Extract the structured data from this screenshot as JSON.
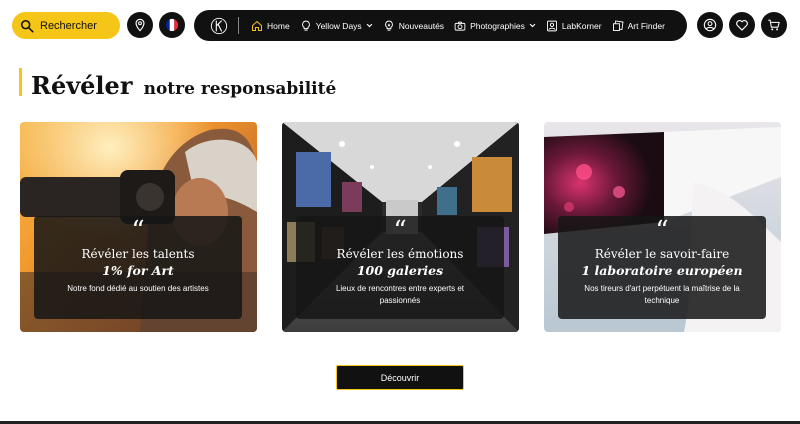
{
  "header": {
    "search": {
      "placeholder": "Rechercher",
      "icon": "search-icon"
    },
    "location_icon": "map-pin-icon",
    "language_icon": "french-flag-icon",
    "flag_colors": [
      "#002395",
      "#ffffff",
      "#ed2939"
    ],
    "nav": [
      {
        "label": "Home",
        "icon": "home-icon",
        "dropdown": false
      },
      {
        "label": "Yellow Days",
        "icon": "bulb-icon",
        "dropdown": true
      },
      {
        "label": "Nouveautés",
        "icon": "sparkle-bulb-icon",
        "dropdown": false
      },
      {
        "label": "Photographies",
        "icon": "camera-icon",
        "dropdown": true
      },
      {
        "label": "LabKorner",
        "icon": "portrait-icon",
        "dropdown": false
      },
      {
        "label": "Art Finder",
        "icon": "art-frames-icon",
        "dropdown": false
      }
    ],
    "account_icon": "user-icon",
    "wishlist_icon": "heart-icon",
    "cart_icon": "cart-icon"
  },
  "section": {
    "title_big": "Révéler",
    "title_small": "notre responsabilité"
  },
  "cards": [
    {
      "quote": "“",
      "title": "Révéler les talents",
      "stat": "1% for Art",
      "desc": "Notre fond dédié au soutien des artistes"
    },
    {
      "quote": "“",
      "title": "Révéler les émotions",
      "stat": "100 galeries",
      "desc": "Lieux de rencontres entre experts et passionnés"
    },
    {
      "quote": "“",
      "title": "Révéler le savoir-faire",
      "stat": "1 laboratoire européen",
      "desc": "Nos tireurs d'art perpétuent la maîtrise de la technique"
    }
  ],
  "cta_label": "Découvrir",
  "colors": {
    "accent": "#f5c518",
    "dark": "#111111"
  }
}
